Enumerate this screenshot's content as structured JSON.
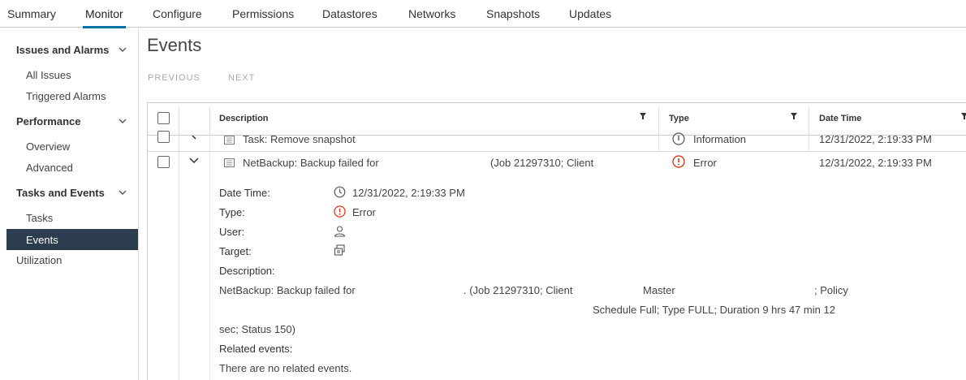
{
  "tabs": [
    "Summary",
    "Monitor",
    "Configure",
    "Permissions",
    "Datastores",
    "Networks",
    "Snapshots",
    "Updates"
  ],
  "sidebar": {
    "issues_header": "Issues and Alarms",
    "all_issues": "All Issues",
    "triggered_alarms": "Triggered Alarms",
    "performance_header": "Performance",
    "overview": "Overview",
    "advanced": "Advanced",
    "tasks_events_header": "Tasks and Events",
    "tasks": "Tasks",
    "events": "Events",
    "utilization": "Utilization"
  },
  "main": {
    "title": "Events",
    "previous": "PREVIOUS",
    "next": "NEXT"
  },
  "grid": {
    "columns": [
      "Description",
      "Type",
      "Date Time"
    ],
    "rows": [
      {
        "description": "Task: Remove snapshot",
        "type": "Information",
        "datetime": "12/31/2022, 2:19:33 PM"
      },
      {
        "description": "NetBackup: Backup failed for",
        "description_tail": "(Job 21297310; Client",
        "type": "Error",
        "datetime": "12/31/2022, 2:19:33 PM"
      }
    ]
  },
  "detail": {
    "datetime_label": "Date Time:",
    "datetime_value": "12/31/2022, 2:19:33 PM",
    "type_label": "Type:",
    "type_value": "Error",
    "user_label": "User:",
    "target_label": "Target:",
    "description_label": "Description:",
    "desc_line1_a": "NetBackup: Backup failed for",
    "desc_line1_b": ". (Job 21297310; Client",
    "desc_line1_c": "Master",
    "desc_line1_d": "; Policy",
    "desc_line2": "Schedule Full; Type FULL; Duration 9 hrs 47 min 12",
    "desc_line3": "sec; Status 150)",
    "related_label": "Related events:",
    "related_value": "There are no related events."
  },
  "colors": {
    "accent": "#0072a3",
    "sidebar_active": "#2b3d4f",
    "error": "#e12200"
  }
}
